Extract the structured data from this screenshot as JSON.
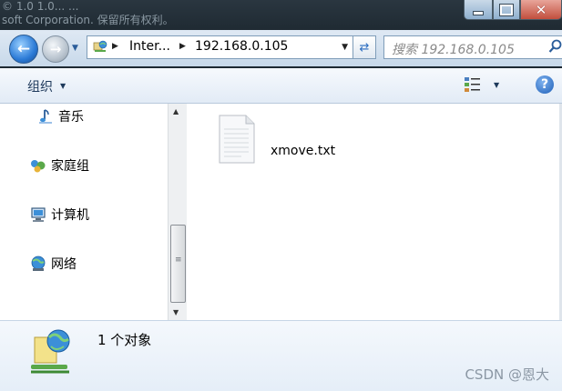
{
  "background": {
    "line1": "© 1.0 1.0... ...",
    "line2": "soft Corporation. 保留所有权利。"
  },
  "address": {
    "segments": [
      "Inter...",
      "192.168.0.105"
    ],
    "search_placeholder": "搜索 192.168.0.105"
  },
  "toolbar": {
    "organize_label": "组织"
  },
  "nav": {
    "items": [
      {
        "label": "音乐",
        "icon": "music-icon"
      },
      {
        "label": "家庭组",
        "icon": "homegroup-icon"
      },
      {
        "label": "计算机",
        "icon": "computer-icon"
      },
      {
        "label": "网络",
        "icon": "network-icon"
      }
    ]
  },
  "files": [
    {
      "name": "xmove.txt",
      "icon": "text-file-icon"
    }
  ],
  "details": {
    "count_text": "1 个对象",
    "icon": "network-share-icon"
  },
  "watermark": "CSDN @恩大",
  "colors": {
    "accent": "#2b7ad6",
    "toolbar_text": "#1e395b"
  }
}
